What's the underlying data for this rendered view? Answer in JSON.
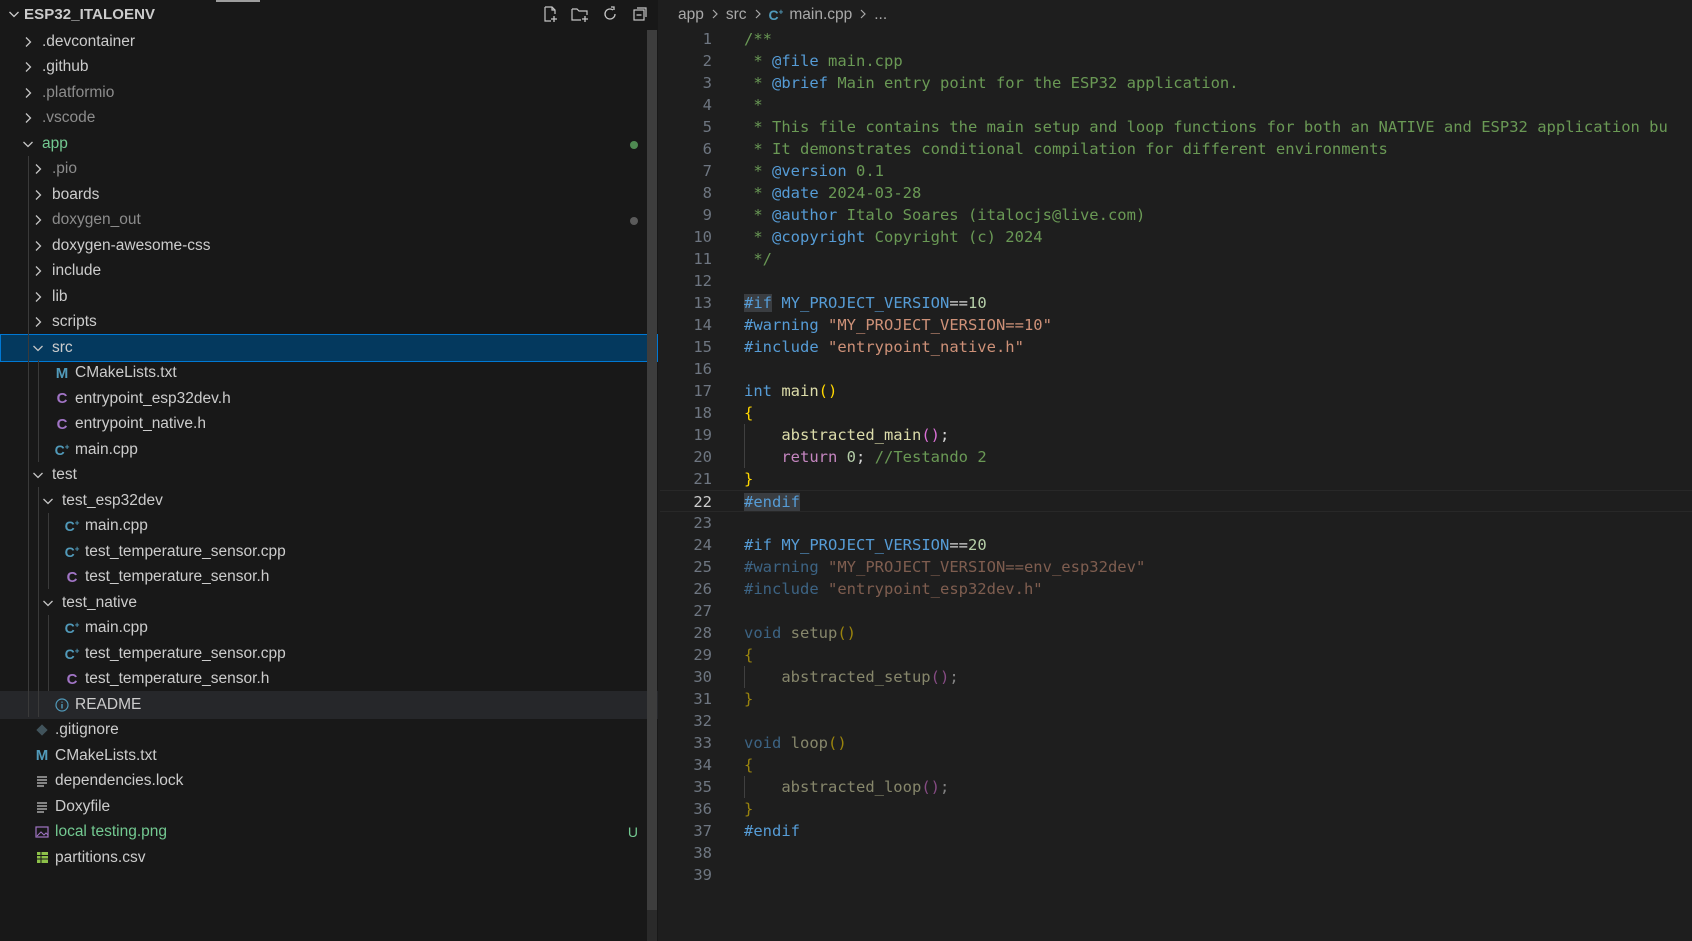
{
  "explorer": {
    "root_label": "ESP32_ITALOENV",
    "actions": [
      {
        "name": "new-file-icon"
      },
      {
        "name": "new-folder-icon"
      },
      {
        "name": "refresh-icon"
      },
      {
        "name": "collapse-all-icon"
      }
    ],
    "items": [
      {
        "label": ".devcontainer",
        "kind": "folder",
        "depth": 0,
        "open": false
      },
      {
        "label": ".github",
        "kind": "folder",
        "depth": 0,
        "open": false
      },
      {
        "label": ".platformio",
        "kind": "folder",
        "depth": 0,
        "open": false,
        "dim": true
      },
      {
        "label": ".vscode",
        "kind": "folder",
        "depth": 0,
        "open": false,
        "dim": true
      },
      {
        "label": "app",
        "kind": "folder",
        "depth": 0,
        "open": true,
        "green": true,
        "dot": "green"
      },
      {
        "label": ".pio",
        "kind": "folder",
        "depth": 1,
        "open": false,
        "dim": true
      },
      {
        "label": "boards",
        "kind": "folder",
        "depth": 1,
        "open": false
      },
      {
        "label": "doxygen_out",
        "kind": "folder",
        "depth": 1,
        "open": false,
        "dim": true,
        "dot": "gray"
      },
      {
        "label": "doxygen-awesome-css",
        "kind": "folder",
        "depth": 1,
        "open": false
      },
      {
        "label": "include",
        "kind": "folder",
        "depth": 1,
        "open": false
      },
      {
        "label": "lib",
        "kind": "folder",
        "depth": 1,
        "open": false
      },
      {
        "label": "scripts",
        "kind": "folder",
        "depth": 1,
        "open": false
      },
      {
        "label": "src",
        "kind": "folder",
        "depth": 1,
        "open": true,
        "selected": true
      },
      {
        "label": "CMakeLists.txt",
        "kind": "cmake",
        "depth": 2
      },
      {
        "label": "entrypoint_esp32dev.h",
        "kind": "c",
        "depth": 2
      },
      {
        "label": "entrypoint_native.h",
        "kind": "c",
        "depth": 2
      },
      {
        "label": "main.cpp",
        "kind": "cpp",
        "depth": 2
      },
      {
        "label": "test",
        "kind": "folder",
        "depth": 1,
        "open": true
      },
      {
        "label": "test_esp32dev",
        "kind": "folder",
        "depth": 2,
        "open": true
      },
      {
        "label": "main.cpp",
        "kind": "cpp",
        "depth": 3
      },
      {
        "label": "test_temperature_sensor.cpp",
        "kind": "cpp",
        "depth": 3
      },
      {
        "label": "test_temperature_sensor.h",
        "kind": "c",
        "depth": 3
      },
      {
        "label": "test_native",
        "kind": "folder",
        "depth": 2,
        "open": true
      },
      {
        "label": "main.cpp",
        "kind": "cpp",
        "depth": 3
      },
      {
        "label": "test_temperature_sensor.cpp",
        "kind": "cpp",
        "depth": 3
      },
      {
        "label": "test_temperature_sensor.h",
        "kind": "c",
        "depth": 3
      },
      {
        "label": "README",
        "kind": "info",
        "depth": 2,
        "hovered": true
      },
      {
        "label": ".gitignore",
        "kind": "git",
        "depth": 0
      },
      {
        "label": "CMakeLists.txt",
        "kind": "cmake",
        "depth": 0
      },
      {
        "label": "dependencies.lock",
        "kind": "lines",
        "depth": 0
      },
      {
        "label": "Doxyfile",
        "kind": "lines",
        "depth": 0
      },
      {
        "label": "local testing.png",
        "kind": "image",
        "depth": 0,
        "green": true,
        "badge": "U"
      },
      {
        "label": "partitions.csv",
        "kind": "csv",
        "depth": 0
      }
    ]
  },
  "breadcrumb": {
    "items": [
      "app",
      "src",
      "main.cpp",
      "..."
    ]
  },
  "editor": {
    "current_line": 22,
    "lines": [
      [
        [
          "/**",
          "t-comment"
        ]
      ],
      [
        [
          " * ",
          "t-comment"
        ],
        [
          "@file",
          "t-doctag"
        ],
        [
          " main.cpp",
          "t-comment"
        ]
      ],
      [
        [
          " * ",
          "t-comment"
        ],
        [
          "@brief",
          "t-doctag"
        ],
        [
          " Main entry point for the ESP32 application.",
          "t-comment"
        ]
      ],
      [
        [
          " *",
          "t-comment"
        ]
      ],
      [
        [
          " * This file contains the main setup and loop functions for both an NATIVE and ESP32 application bu",
          "t-comment"
        ]
      ],
      [
        [
          " * It demonstrates conditional compilation for different environments",
          "t-comment"
        ]
      ],
      [
        [
          " * ",
          "t-comment"
        ],
        [
          "@version",
          "t-doctag"
        ],
        [
          " 0.1",
          "t-comment"
        ]
      ],
      [
        [
          " * ",
          "t-comment"
        ],
        [
          "@date",
          "t-doctag"
        ],
        [
          " 2024-03-28",
          "t-comment"
        ]
      ],
      [
        [
          " * ",
          "t-comment"
        ],
        [
          "@author",
          "t-doctag"
        ],
        [
          " Italo Soares (italocjs@live.com)",
          "t-comment"
        ]
      ],
      [
        [
          " * ",
          "t-comment"
        ],
        [
          "@copyright",
          "t-doctag"
        ],
        [
          " Copyright (c) 2024",
          "t-comment"
        ]
      ],
      [
        [
          " */",
          "t-comment"
        ]
      ],
      [],
      [
        [
          "#if",
          "t-pp-hl"
        ],
        [
          " ",
          "t-plain"
        ],
        [
          "MY_PROJECT_VERSION",
          "t-macro"
        ],
        [
          "==",
          "t-plain"
        ],
        [
          "10",
          "t-num"
        ]
      ],
      [
        [
          "#warning",
          "t-pp"
        ],
        [
          " ",
          "t-plain"
        ],
        [
          "\"MY_PROJECT_VERSION==10\"",
          "t-str"
        ]
      ],
      [
        [
          "#include",
          "t-pp"
        ],
        [
          " ",
          "t-plain"
        ],
        [
          "\"entrypoint_native.h\"",
          "t-str"
        ]
      ],
      [],
      [
        [
          "int",
          "t-kw"
        ],
        [
          " ",
          "t-plain"
        ],
        [
          "main",
          "t-fn"
        ],
        [
          "()",
          "t-b1"
        ]
      ],
      [
        [
          "{",
          "t-b1"
        ]
      ],
      [
        [
          "    ",
          "t-plain"
        ],
        [
          "abstracted_main",
          "t-fn"
        ],
        [
          "()",
          "t-b2"
        ],
        [
          ";",
          "t-plain"
        ]
      ],
      [
        [
          "    ",
          "t-plain"
        ],
        [
          "return",
          "t-ctrl"
        ],
        [
          " ",
          "t-plain"
        ],
        [
          "0",
          "t-num"
        ],
        [
          "; ",
          "t-plain"
        ],
        [
          "//Testando 2",
          "t-comment"
        ]
      ],
      [
        [
          "}",
          "t-b1"
        ]
      ],
      [
        [
          "#endif",
          "t-pp-hl"
        ]
      ],
      [],
      [
        [
          "#if",
          "t-pp"
        ],
        [
          " ",
          "t-plain"
        ],
        [
          "MY_PROJECT_VERSION",
          "t-macro"
        ],
        [
          "==",
          "t-plain"
        ],
        [
          "20",
          "t-num"
        ]
      ],
      [
        [
          "#warning",
          "t-pp t-inactive"
        ],
        [
          " ",
          "t-plain"
        ],
        [
          "\"MY_PROJECT_VERSION==env_esp32dev\"",
          "t-str t-inactive"
        ]
      ],
      [
        [
          "#include",
          "t-pp t-inactive"
        ],
        [
          " ",
          "t-plain"
        ],
        [
          "\"entrypoint_esp32dev.h\"",
          "t-str t-inactive"
        ]
      ],
      [],
      [
        [
          "void",
          "t-kw t-inactive"
        ],
        [
          " ",
          "t-plain"
        ],
        [
          "setup",
          "t-fn t-inactive"
        ],
        [
          "()",
          "t-b1 t-inactive"
        ]
      ],
      [
        [
          "{",
          "t-b1 t-inactive"
        ]
      ],
      [
        [
          "    ",
          "t-plain"
        ],
        [
          "abstracted_setup",
          "t-fn t-inactive"
        ],
        [
          "()",
          "t-b2 t-inactive"
        ],
        [
          ";",
          "t-plain t-inactive"
        ]
      ],
      [
        [
          "}",
          "t-b1 t-inactive"
        ]
      ],
      [],
      [
        [
          "void",
          "t-kw t-inactive"
        ],
        [
          " ",
          "t-plain"
        ],
        [
          "loop",
          "t-fn t-inactive"
        ],
        [
          "()",
          "t-b1 t-inactive"
        ]
      ],
      [
        [
          "{",
          "t-b1 t-inactive"
        ]
      ],
      [
        [
          "    ",
          "t-plain"
        ],
        [
          "abstracted_loop",
          "t-fn t-inactive"
        ],
        [
          "()",
          "t-b2 t-inactive"
        ],
        [
          ";",
          "t-plain t-inactive"
        ]
      ],
      [
        [
          "}",
          "t-b1 t-inactive"
        ]
      ],
      [
        [
          "#endif",
          "t-pp"
        ]
      ],
      [],
      []
    ]
  }
}
